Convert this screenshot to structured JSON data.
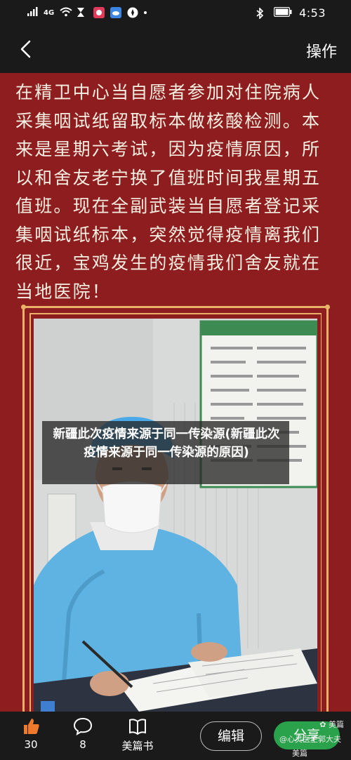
{
  "status_bar": {
    "network": "4G",
    "time": "4:53"
  },
  "nav": {
    "action_label": "操作"
  },
  "article": {
    "text": "在精卫中心当自愿者参加对住院病人采集咽试纸留取标本做核酸检测。本来是星期六考试，因为疫情原因，所以和舍友老宁换了值班时间我星期五值班。现在全副武装当自愿者登记采集咽试纸标本，突然觉得疫情离我们很近，宝鸡发生的疫情我们舍友就在当地医院！"
  },
  "overlay": {
    "caption": "新疆此次疫情来源于同一传染源(新疆此次疫情来源于同一传染源的原因)"
  },
  "bottom_bar": {
    "like_count": "30",
    "comment_count": "8",
    "book_label": "美篇书",
    "edit_label": "编辑",
    "share_label": "分享",
    "watermark_brand": "美篇",
    "watermark_author": "@心灵医生郭大夫",
    "watermark_id": "美篇号:6813191"
  },
  "colors": {
    "background": "#8e1d1f",
    "frame_gold": "#e9b268",
    "share_green": "#2aa24c",
    "like_orange": "#f07a2b"
  }
}
